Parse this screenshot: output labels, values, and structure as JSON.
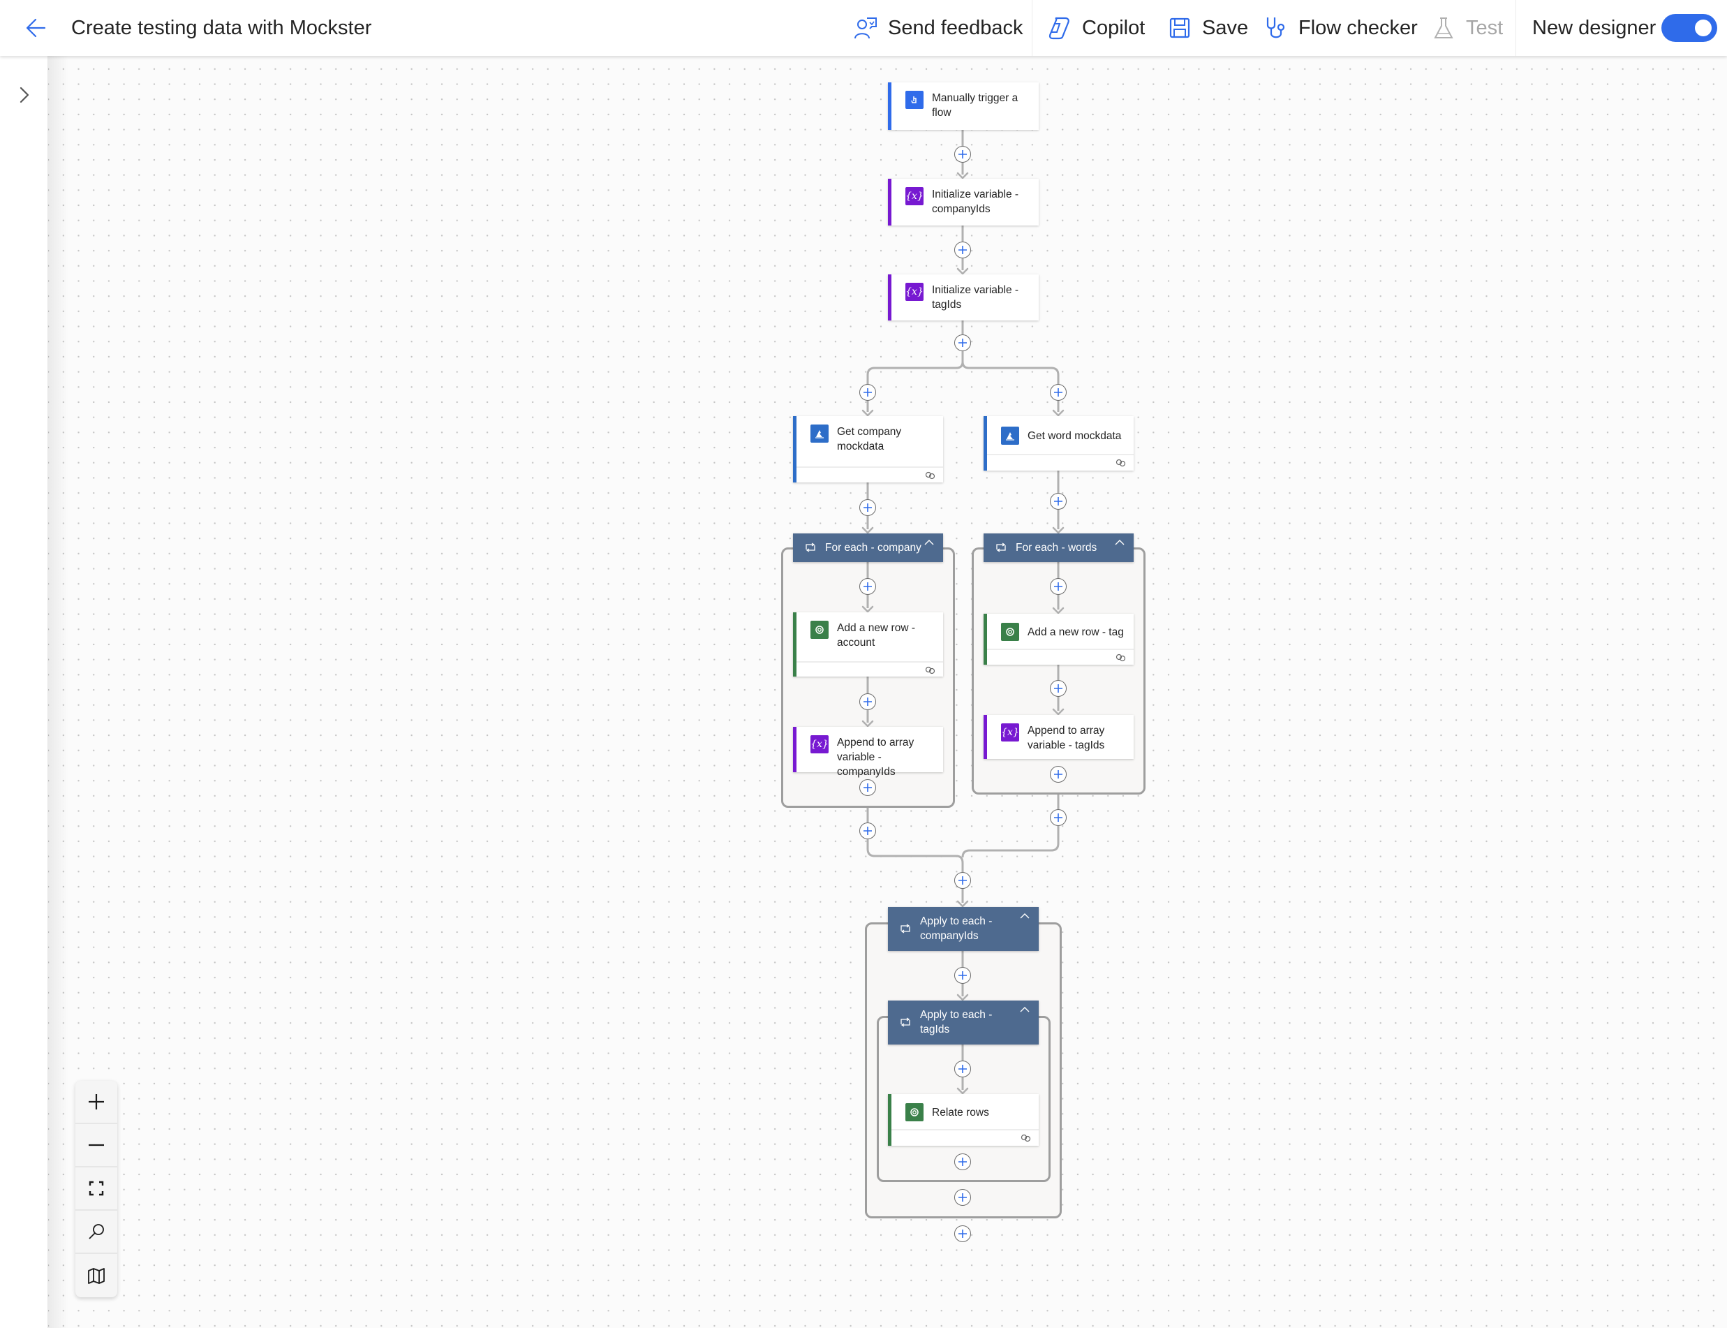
{
  "header": {
    "title": "Create testing data with Mockster",
    "toolbar": {
      "send_feedback": "Send feedback",
      "copilot": "Copilot",
      "save": "Save",
      "flow_checker": "Flow checker",
      "test": "Test",
      "new_designer": "New designer"
    },
    "new_designer_enabled": true
  },
  "colors": {
    "accent": "#2f6bea",
    "trigger": "#2f6bea",
    "variable": "#7719d1",
    "dataverse": "#3a8049",
    "mockster": "#2d6dc8",
    "loop_header": "#4e6a8f"
  },
  "flow": {
    "trigger": {
      "label": "Manually trigger a flow",
      "icon": "touch-icon"
    },
    "init_company_ids": {
      "label": "Initialize variable - companyIds",
      "icon": "variable-icon"
    },
    "init_tag_ids": {
      "label": "Initialize variable - tagIds",
      "icon": "variable-icon"
    },
    "branches": [
      {
        "get_mock": {
          "label": "Get company mockdata",
          "icon": "mockster-icon"
        },
        "loop": {
          "label": "For each - company"
        },
        "actions": [
          {
            "label": "Add a new row - account",
            "icon": "dataverse-icon"
          },
          {
            "label": "Append to array variable - companyIds",
            "icon": "variable-icon"
          }
        ]
      },
      {
        "get_mock": {
          "label": "Get word mockdata",
          "icon": "mockster-icon"
        },
        "loop": {
          "label": "For each - words"
        },
        "actions": [
          {
            "label": "Add a new row - tag",
            "icon": "dataverse-icon"
          },
          {
            "label": "Append to array variable - tagIds",
            "icon": "variable-icon"
          }
        ]
      }
    ],
    "apply_company_ids": {
      "label": "Apply to each - companyIds"
    },
    "apply_tag_ids": {
      "label": "Apply to each - tagIds"
    },
    "relate_rows": {
      "label": "Relate rows",
      "icon": "dataverse-icon"
    }
  },
  "zoom_controls": [
    "zoom-in",
    "zoom-out",
    "fit-view",
    "search",
    "minimap"
  ]
}
